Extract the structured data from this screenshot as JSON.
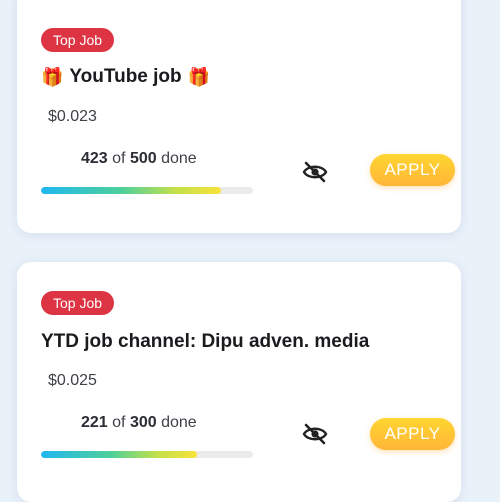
{
  "jobs": [
    {
      "badge": "Top Job",
      "title": "YouTube job",
      "title_icons": [
        "gift-icon",
        "gift-icon"
      ],
      "price": "$0.023",
      "done": "423",
      "of": "of",
      "total": "500",
      "done_label": "done",
      "progress": 0.85,
      "apply_label": "APPLY"
    },
    {
      "badge": "Top Job",
      "title": "YTD job channel: Dipu adven. media",
      "title_icons": [],
      "price": "$0.025",
      "done": "221",
      "of": "of",
      "total": "300",
      "done_label": "done",
      "progress": 0.737,
      "apply_label": "APPLY"
    }
  ],
  "colors": {
    "badge": "#dd3444",
    "apply_start": "#ffd630",
    "apply_end": "#ffb638",
    "progress_start": "#1fb8f0",
    "progress_end": "#f7e23b"
  }
}
